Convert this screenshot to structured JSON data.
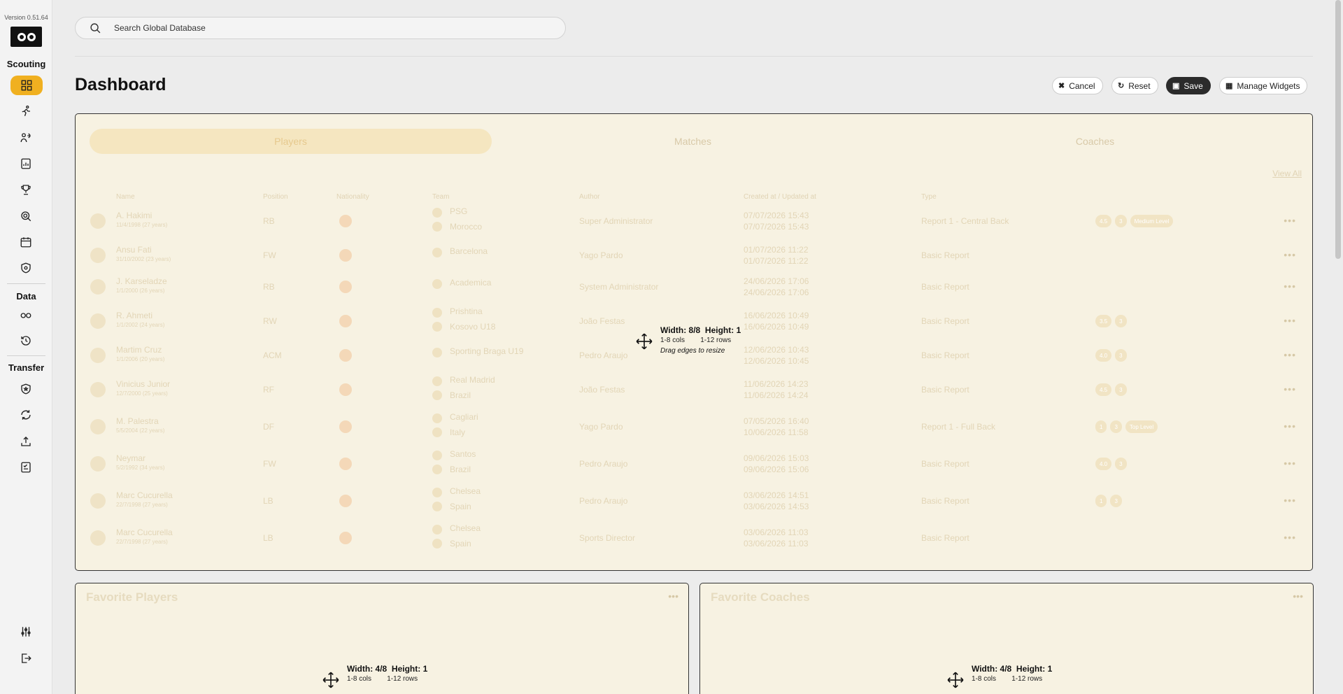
{
  "app": {
    "version": "Version 0.51.64"
  },
  "sidebar": {
    "sections": [
      {
        "label": "Scouting"
      },
      {
        "label": "Data"
      },
      {
        "label": "Transfer"
      }
    ]
  },
  "search": {
    "placeholder": "Search Global Database"
  },
  "page": {
    "title": "Dashboard"
  },
  "toolbar": {
    "cancel_label": "Cancel",
    "reset_label": "Reset",
    "save_label": "Save",
    "manage_label": "Manage Widgets"
  },
  "main_widget": {
    "tabs": [
      "Players",
      "Matches",
      "Coaches"
    ],
    "view_all": "View All",
    "columns": [
      "Name",
      "Position",
      "Nationality",
      "Team",
      "Author",
      "Created at / Updated at",
      "Type"
    ],
    "rows": [
      {
        "name": "A. Hakimi",
        "dob": "11/4/1998 (27 years)",
        "position": "RB",
        "team1": "PSG",
        "team2": "Morocco",
        "author": "Super Administrator",
        "date1": "07/07/2026 15:43",
        "date2": "07/07/2026 15:43",
        "type": "Report 1 - Central Back",
        "badges": [
          "4.5",
          "3",
          "Medium Level"
        ]
      },
      {
        "name": "Ansu Fati",
        "dob": "31/10/2002 (23 years)",
        "position": "FW",
        "team1": "Barcelona",
        "team2": "",
        "author": "Yago Pardo",
        "date1": "01/07/2026 11:22",
        "date2": "01/07/2026 11:22",
        "type": "Basic Report",
        "badges": []
      },
      {
        "name": "J. Karseladze",
        "dob": "1/1/2000 (26 years)",
        "position": "RB",
        "team1": "Academica",
        "team2": "",
        "author": "System Administrator",
        "date1": "24/06/2026 17:06",
        "date2": "24/06/2026 17:06",
        "type": "Basic Report",
        "badges": []
      },
      {
        "name": "R. Ahmeti",
        "dob": "1/1/2002 (24 years)",
        "position": "RW",
        "team1": "Prishtina",
        "team2": "Kosovo U18",
        "author": "João Festas",
        "date1": "16/06/2026 10:49",
        "date2": "16/06/2026 10:49",
        "type": "Basic Report",
        "badges": [
          "3.5",
          "3"
        ]
      },
      {
        "name": "Martim Cruz",
        "dob": "1/1/2006 (20 years)",
        "position": "ACM",
        "team1": "Sporting Braga U19",
        "team2": "",
        "author": "Pedro Araujo",
        "date1": "12/06/2026 10:43",
        "date2": "12/06/2026 10:45",
        "type": "Basic Report",
        "badges": [
          "4.0",
          "3"
        ]
      },
      {
        "name": "Vinicius Junior",
        "dob": "12/7/2000 (25 years)",
        "position": "RF",
        "team1": "Real Madrid",
        "team2": "Brazil",
        "author": "João Festas",
        "date1": "11/06/2026 14:23",
        "date2": "11/06/2026 14:24",
        "type": "Basic Report",
        "badges": [
          "4.5",
          "3"
        ]
      },
      {
        "name": "M. Palestra",
        "dob": "5/5/2004 (22 years)",
        "position": "DF",
        "team1": "Cagliari",
        "team2": "Italy",
        "author": "Yago Pardo",
        "date1": "07/05/2026 16:40",
        "date2": "10/06/2026 11:58",
        "type": "Report 1 - Full Back",
        "badges": [
          "1",
          "3",
          "Top Level"
        ]
      },
      {
        "name": "Neymar",
        "dob": "5/2/1992 (34 years)",
        "position": "FW",
        "team1": "Santos",
        "team2": "Brazil",
        "author": "Pedro Araujo",
        "date1": "09/06/2026 15:03",
        "date2": "09/06/2026 15:06",
        "type": "Basic Report",
        "badges": [
          "4.0",
          "3"
        ]
      },
      {
        "name": "Marc Cucurella",
        "dob": "22/7/1998 (27 years)",
        "position": "LB",
        "team1": "Chelsea",
        "team2": "Spain",
        "author": "Pedro Araujo",
        "date1": "03/06/2026 14:51",
        "date2": "03/06/2026 14:53",
        "type": "Basic Report",
        "badges": [
          "1",
          "3"
        ]
      },
      {
        "name": "Marc Cucurella",
        "dob": "22/7/1998 (27 years)",
        "position": "LB",
        "team1": "Chelsea",
        "team2": "Spain",
        "author": "Sports Director",
        "date1": "03/06/2026 11:03",
        "date2": "03/06/2026 11:03",
        "type": "Basic Report",
        "badges": []
      }
    ],
    "resize": {
      "width_label": "Width: 8/8",
      "height_label": "Height: 1",
      "cols": "1-8 cols",
      "rows": "1-12 rows",
      "hint": "Drag edges to resize"
    }
  },
  "favorite_players": {
    "title": "Favorite Players",
    "resize": {
      "width_label": "Width: 4/8",
      "height_label": "Height: 1",
      "cols": "1-8 cols",
      "rows": "1-12 rows"
    }
  },
  "favorite_coaches": {
    "title": "Favorite Coaches",
    "resize": {
      "width_label": "Width: 4/8",
      "height_label": "Height: 1",
      "cols": "1-8 cols",
      "rows": "1-12 rows"
    }
  }
}
